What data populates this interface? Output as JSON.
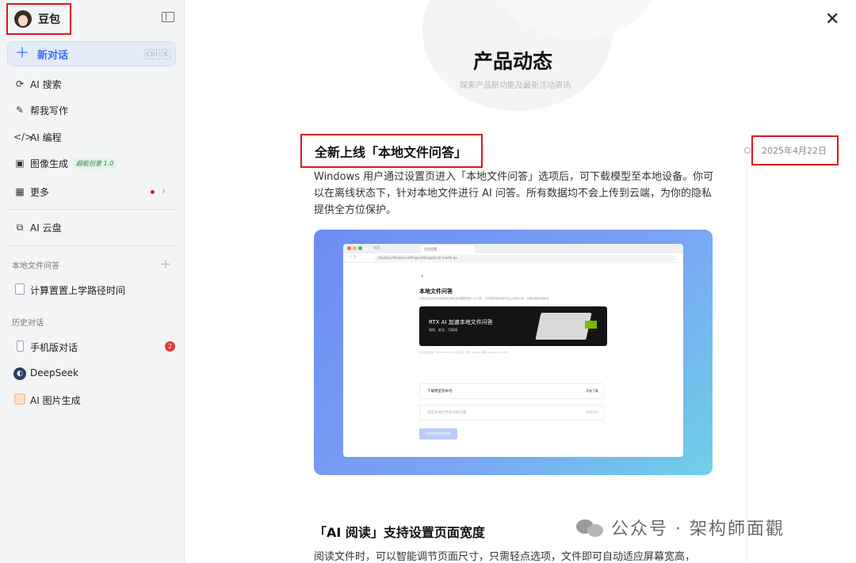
{
  "sidebar": {
    "brand": "豆包",
    "new_chat": {
      "label": "新对话",
      "shortcut": [
        "Ctrl",
        "K"
      ]
    },
    "nav": [
      {
        "icon": "ai-search-icon",
        "label": "AI 搜索"
      },
      {
        "icon": "pen-icon",
        "label": "帮我写作"
      },
      {
        "icon": "code-icon",
        "label": "AI 编程"
      },
      {
        "icon": "image-icon",
        "label": "图像生成",
        "badge": "超能创意 1.0"
      },
      {
        "icon": "grid-icon",
        "label": "更多"
      }
    ],
    "cloud": {
      "icon": "cloud-drive-icon",
      "label": "AI 云盘"
    },
    "local_qa_title": "本地文件问答",
    "local_qa_items": [
      {
        "label": "计算置置上学路径时间"
      }
    ],
    "history_title": "历史对话",
    "history": [
      {
        "label": "手机版对话",
        "count": "2"
      },
      {
        "label": "DeepSeek"
      },
      {
        "label": "AI 图片生成"
      }
    ]
  },
  "main": {
    "title": "产品动态",
    "subtitle": "探索产品新功能及最新活动资讯",
    "feature1": {
      "title": "全新上线「本地文件问答」",
      "date": "2025年4月22日",
      "desc": "Windows 用户通过设置页进入「本地文件问答」选项后，可下载模型至本地设备。你可以在离线状态下，针对本地文件进行 AI 问答。所有数据均不会上传到云端，为你的隐私提供全方位保护。",
      "screenshot": {
        "tab_home": "主页",
        "tab_active": "豆包设置",
        "url": "doubao://doubao-settings/settings/local-model-qa",
        "heading": "本地文件问答",
        "heading_desc": "开启后可以针对本地文件使用本地模型进行 AI 问答，文件和对话内容不会上传到云端，功能仅限本机使用",
        "banner_title": "RTX AI 加速本地文件问答",
        "banner_sub": "高效、安全、可离线",
        "requirement": "最低配置要求：NVIDIA RTX 30 系列显卡，显存 ≥ 8GB，推荐 Windows 11 系统",
        "row1_label": "下载模型到本地",
        "row1_action": "开始下载",
        "row2_label": "指定本地文件作为知识库",
        "row2_action": "选择文件",
        "button": "开始使用本地问答"
      }
    },
    "feature2": {
      "title": "「AI 阅读」支持设置页面宽度",
      "desc": "阅读文件时，可以智能调节页面尺寸，只需轻点选项，文件即可自动适应屏幕宽高，"
    },
    "watermark": "公众号 · 架构師面觀"
  }
}
